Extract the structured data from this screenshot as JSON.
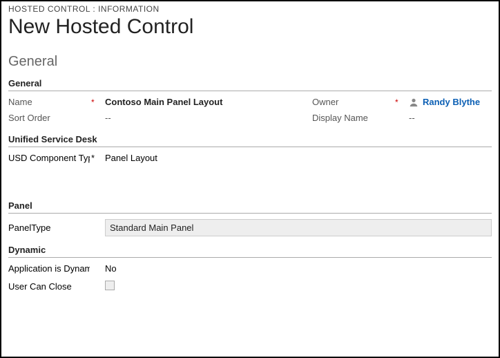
{
  "breadcrumb": "HOSTED CONTROL : INFORMATION",
  "page_title": "New Hosted Control",
  "section_title": "General",
  "groups": {
    "general": {
      "header": "General",
      "name_label": "Name",
      "name_value": "Contoso Main Panel Layout",
      "owner_label": "Owner",
      "owner_value": "Randy Blythe",
      "sort_order_label": "Sort Order",
      "sort_order_value": "--",
      "display_name_label": "Display Name",
      "display_name_value": "--"
    },
    "usd": {
      "header": "Unified Service Desk",
      "component_label": "USD Component Type",
      "component_value": "Panel Layout"
    },
    "panel": {
      "header": "Panel",
      "panel_type_label": "PanelType",
      "panel_type_value": "Standard Main Panel"
    },
    "dynamic": {
      "header": "Dynamic",
      "app_dynamic_label": "Application is Dynamic",
      "app_dynamic_value": "No",
      "user_close_label": "User Can Close"
    }
  },
  "required_marker": "*"
}
